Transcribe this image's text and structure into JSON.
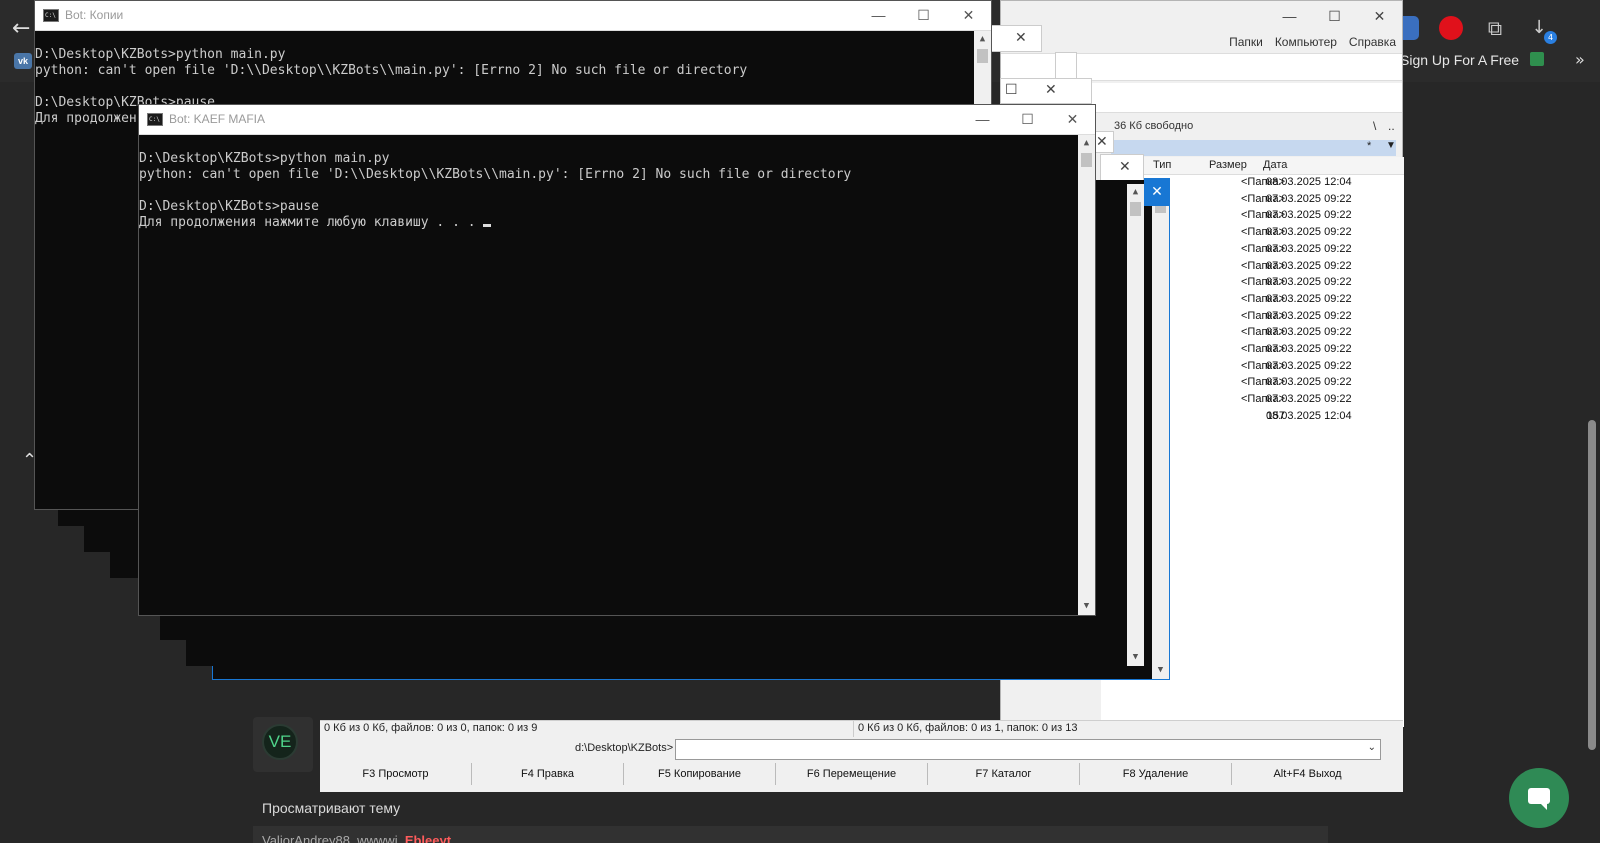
{
  "browser": {
    "bookmark_label": "Sign Up For A Free",
    "download_badge": "4",
    "bookmark_more": "»"
  },
  "forum": {
    "avatar_initials": "VE",
    "viewing_label": "Просматривают тему",
    "viewer_names_plain": "ValiorAndrey88, wwwwi, ",
    "viewer_names_highlight": "Ebleeyt"
  },
  "total_commander": {
    "menu": [
      "Папки",
      "Компьютер",
      "Справка"
    ],
    "free_space": "36 Кб свободно",
    "root_btn": "\\",
    "up_btn": "..",
    "filter": "*",
    "columns": {
      "type": "Тип",
      "size": "Размер",
      "date": "Дата"
    },
    "rows": [
      {
        "size": "<Папка>",
        "date": "08.03.2025 12:04"
      },
      {
        "size": "<Папка>",
        "date": "07.03.2025 09:22"
      },
      {
        "size": "<Папка>",
        "date": "07.03.2025 09:22"
      },
      {
        "size": "<Папка>",
        "date": "07.03.2025 09:22"
      },
      {
        "size": "<Папка>",
        "date": "07.03.2025 09:22"
      },
      {
        "size": "<Папка>",
        "date": "07.03.2025 09:22"
      },
      {
        "size": "<Папка>",
        "date": "07.03.2025 09:22"
      },
      {
        "size": "<Папка>",
        "date": "07.03.2025 09:22"
      },
      {
        "size": "<Папка>",
        "date": "07.03.2025 09:22"
      },
      {
        "size": "<Папка>",
        "date": "07.03.2025 09:22"
      },
      {
        "size": "<Папка>",
        "date": "07.03.2025 09:22"
      },
      {
        "size": "<Папка>",
        "date": "07.03.2025 09:22"
      },
      {
        "size": "<Папка>",
        "date": "07.03.2025 09:22"
      },
      {
        "size": "<Папка>",
        "date": "07.03.2025 09:22"
      },
      {
        "size": "157",
        "date": "08.03.2025 12:04"
      }
    ],
    "status_left": "0 Кб из 0 Кб, файлов: 0 из 0, папок: 0 из 9",
    "status_right": "0 Кб из 0 Кб, файлов: 0 из 1, папок: 0 из 13",
    "cmd_path": "d:\\Desktop\\KZBots>",
    "fkeys": [
      "F3 Просмотр",
      "F4 Правка",
      "F5 Копирование",
      "F6 Перемещение",
      "F7 Каталог",
      "F8 Удаление",
      "Alt+F4 Выход"
    ]
  },
  "console_back": {
    "title": "Bot: Копии",
    "lines": "D:\\Desktop\\KZBots>python main.py\npython: can't open file 'D:\\\\Desktop\\\\KZBots\\\\main.py': [Errno 2] No such file or directory\n\nD:\\Desktop\\KZBots>pause\nДля продолжен"
  },
  "console_front": {
    "title": "Bot: KAEF MAFIA",
    "lines": "D:\\Desktop\\KZBots>python main.py\npython: can't open file 'D:\\\\Desktop\\\\KZBots\\\\main.py': [Errno 2] No such file or directory\n\nD:\\Desktop\\KZBots>pause\nДля продолжения нажмите любую клавишу . . . "
  }
}
